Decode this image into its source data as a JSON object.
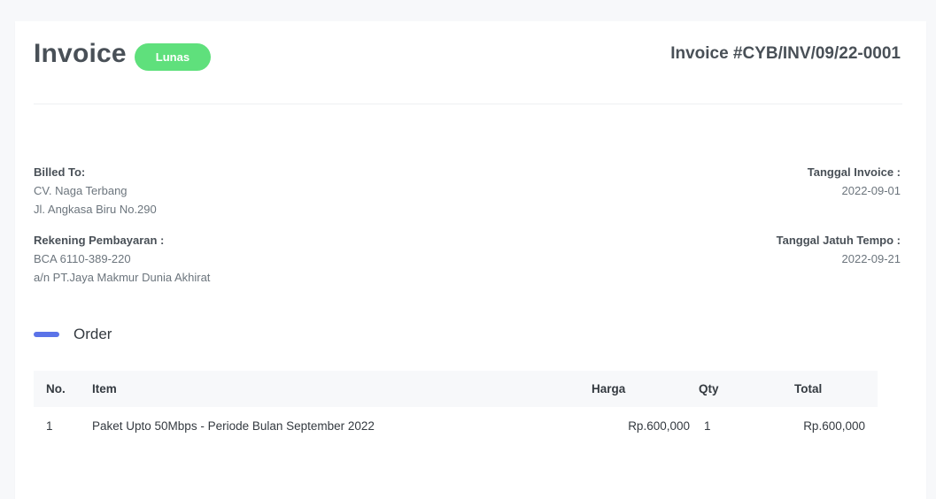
{
  "header": {
    "title": "Invoice",
    "status_badge": "Lunas",
    "invoice_number": "Invoice #CYB/INV/09/22-0001"
  },
  "billed_to": {
    "label": "Billed To:",
    "name": "CV. Naga Terbang",
    "address": "Jl. Angkasa Biru No.290"
  },
  "payment_account": {
    "label": "Rekening Pembayaran :",
    "account": "BCA 6110-389-220",
    "holder": "a/n PT.Jaya Makmur Dunia Akhirat"
  },
  "invoice_date": {
    "label": "Tanggal Invoice :",
    "value": "2022-09-01"
  },
  "due_date": {
    "label": "Tanggal Jatuh Tempo :",
    "value": "2022-09-21"
  },
  "order": {
    "section_title": "Order",
    "columns": [
      "No.",
      "Item",
      "Harga",
      "Qty",
      "Total"
    ],
    "rows": [
      [
        "1",
        "Paket Upto 50Mbps - Periode Bulan September 2022",
        "Rp.600,000",
        "1",
        "Rp.600,000"
      ]
    ]
  },
  "colors": {
    "badge": "#5fe07c",
    "accent": "#5b73e8",
    "text": "#495057"
  }
}
